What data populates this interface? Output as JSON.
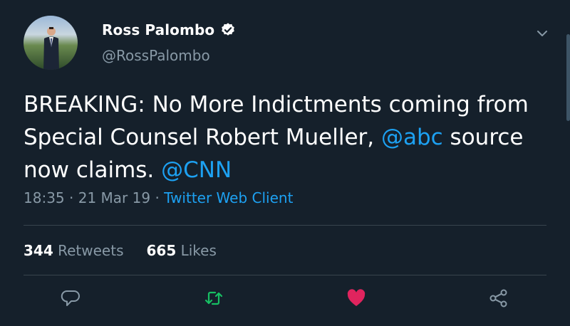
{
  "user": {
    "display_name": "Ross Palombo",
    "handle": "@RossPalombo",
    "verified": true
  },
  "tweet": {
    "text_part1": "BREAKING: No More Indictments coming from Special Counsel Robert Mueller, ",
    "mention1": "@abc",
    "text_part2": " source now claims. ",
    "mention2": "@CNN"
  },
  "meta": {
    "time": "18:35",
    "date": "21 Mar 19",
    "client": "Twitter Web Client"
  },
  "stats": {
    "retweets_count": "344",
    "retweets_label": "Retweets",
    "likes_count": "665",
    "likes_label": "Likes"
  },
  "colors": {
    "background": "#15202b",
    "accent": "#1da1f2",
    "muted": "#8899a6",
    "retweet": "#17bf63",
    "like": "#e0245e"
  },
  "icons": [
    "verified-badge-icon",
    "chevron-down-icon",
    "reply-icon",
    "retweet-icon",
    "like-icon",
    "share-icon"
  ]
}
